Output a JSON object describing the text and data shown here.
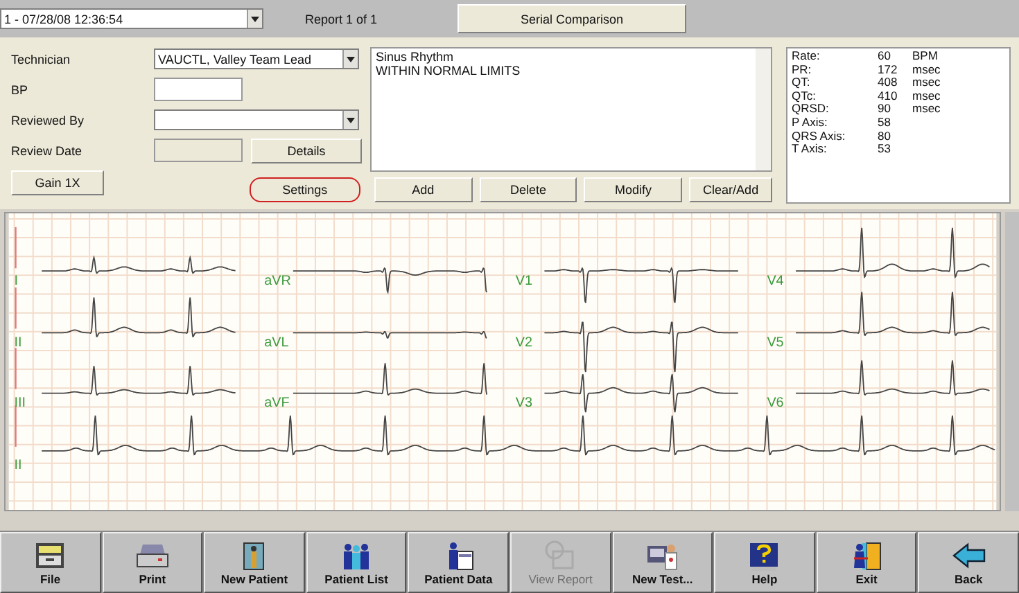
{
  "report_select": {
    "value": "1 - 07/28/08 12:36:54"
  },
  "report_count": "Report 1 of 1",
  "serial_button": "Serial Comparison",
  "form": {
    "technician_label": "Technician",
    "technician_value": "VAUCTL, Valley Team Lead",
    "bp_label": "BP",
    "reviewed_by_label": "Reviewed By",
    "review_date_label": "Review Date",
    "details_button": "Details"
  },
  "interpretation": [
    "Sinus Rhythm",
    "WITHIN NORMAL LIMITS"
  ],
  "measurements": [
    {
      "label": "Rate:",
      "value": "60",
      "unit": "BPM"
    },
    {
      "label": "PR:",
      "value": "172",
      "unit": "msec"
    },
    {
      "label": "QT:",
      "value": "408",
      "unit": "msec"
    },
    {
      "label": "QTc:",
      "value": "410",
      "unit": "msec"
    },
    {
      "label": "QRSD:",
      "value": "90",
      "unit": "msec"
    },
    {
      "label": "P Axis:",
      "value": "58"
    },
    {
      "label": "QRS Axis:",
      "value": "80"
    },
    {
      "label": "T Axis:",
      "value": "53"
    }
  ],
  "gain_button": "Gain 1X",
  "action_buttons": [
    {
      "label": "Settings",
      "highlighted": true
    },
    {
      "label": "Add",
      "highlighted": false
    },
    {
      "label": "Delete",
      "highlighted": false
    },
    {
      "label": "Modify",
      "highlighted": false
    },
    {
      "label": "Clear/Add",
      "highlighted": false
    }
  ],
  "ecg": {
    "leads": [
      "I",
      "II",
      "III",
      "aVR",
      "aVL",
      "aVF",
      "V1",
      "V2",
      "V3",
      "V4",
      "V5",
      "V6"
    ],
    "rhythm_lead": "II"
  },
  "toolbar": [
    {
      "label": "File",
      "disabled": false
    },
    {
      "label": "Print",
      "disabled": false
    },
    {
      "label": "New Patient",
      "disabled": false
    },
    {
      "label": "Patient List",
      "disabled": false
    },
    {
      "label": "Patient Data",
      "disabled": false
    },
    {
      "label": "View Report",
      "disabled": true
    },
    {
      "label": "New Test...",
      "disabled": false
    },
    {
      "label": "Help",
      "disabled": false
    },
    {
      "label": "Exit",
      "disabled": false
    },
    {
      "label": "Back",
      "disabled": false
    }
  ]
}
